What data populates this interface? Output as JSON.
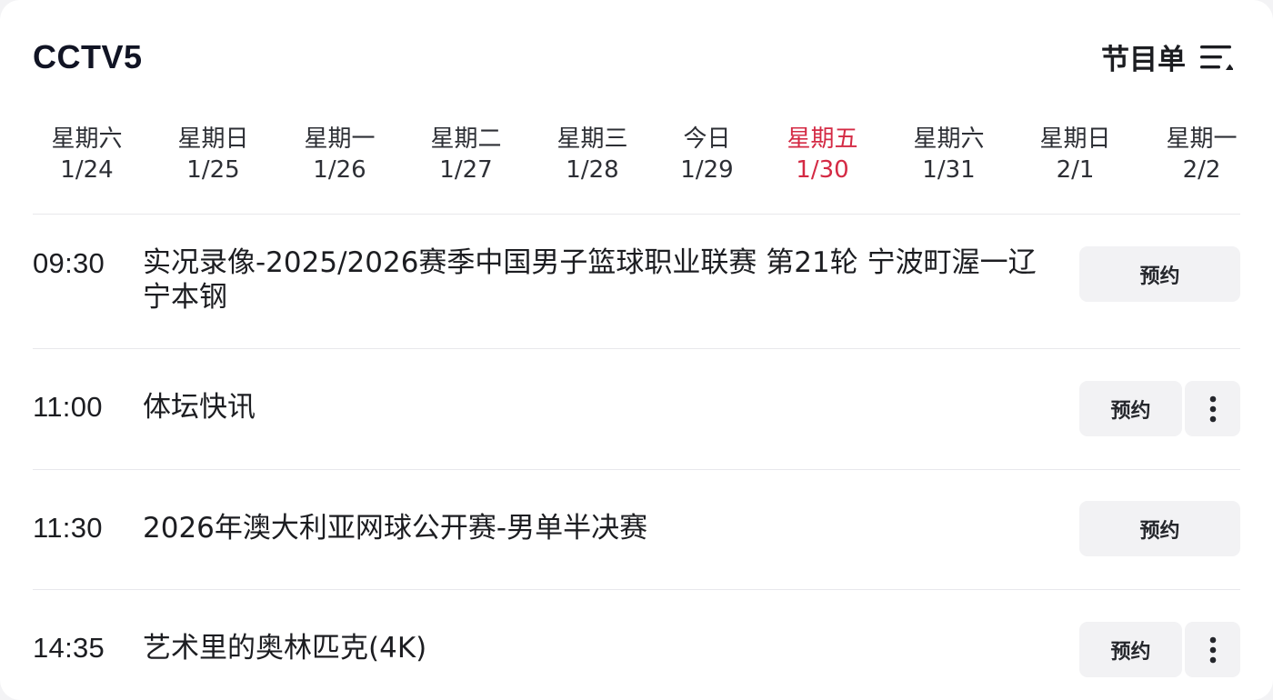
{
  "header": {
    "channel": "CCTV5",
    "schedule_label": "节目单",
    "schedule_icon": "list-sort-icon"
  },
  "days": [
    {
      "name": "星期六",
      "date": "1/24",
      "active": false
    },
    {
      "name": "星期日",
      "date": "1/25",
      "active": false
    },
    {
      "name": "星期一",
      "date": "1/26",
      "active": false
    },
    {
      "name": "星期二",
      "date": "1/27",
      "active": false
    },
    {
      "name": "星期三",
      "date": "1/28",
      "active": false
    },
    {
      "name": "今日",
      "date": "1/29",
      "active": false
    },
    {
      "name": "星期五",
      "date": "1/30",
      "active": true
    },
    {
      "name": "星期六",
      "date": "1/31",
      "active": false
    },
    {
      "name": "星期日",
      "date": "2/1",
      "active": false
    },
    {
      "name": "星期一",
      "date": "2/2",
      "active": false
    }
  ],
  "programs": [
    {
      "time": "09:30",
      "title": "实况录像-2025/2026赛季中国男子篮球职业联赛 第21轮 宁波町渥一辽宁本钢",
      "action": "预约",
      "has_more": false
    },
    {
      "time": "11:00",
      "title": "体坛快讯",
      "action": "预约",
      "has_more": true
    },
    {
      "time": "11:30",
      "title": "2026年澳大利亚网球公开赛-男单半决赛",
      "action": "预约",
      "has_more": false
    },
    {
      "time": "14:35",
      "title": "艺术里的奥林匹克(4K)",
      "action": "预约",
      "has_more": true
    }
  ],
  "colors": {
    "accent": "#d42a44",
    "text": "#1c1d21",
    "button_bg": "#f2f2f4"
  }
}
